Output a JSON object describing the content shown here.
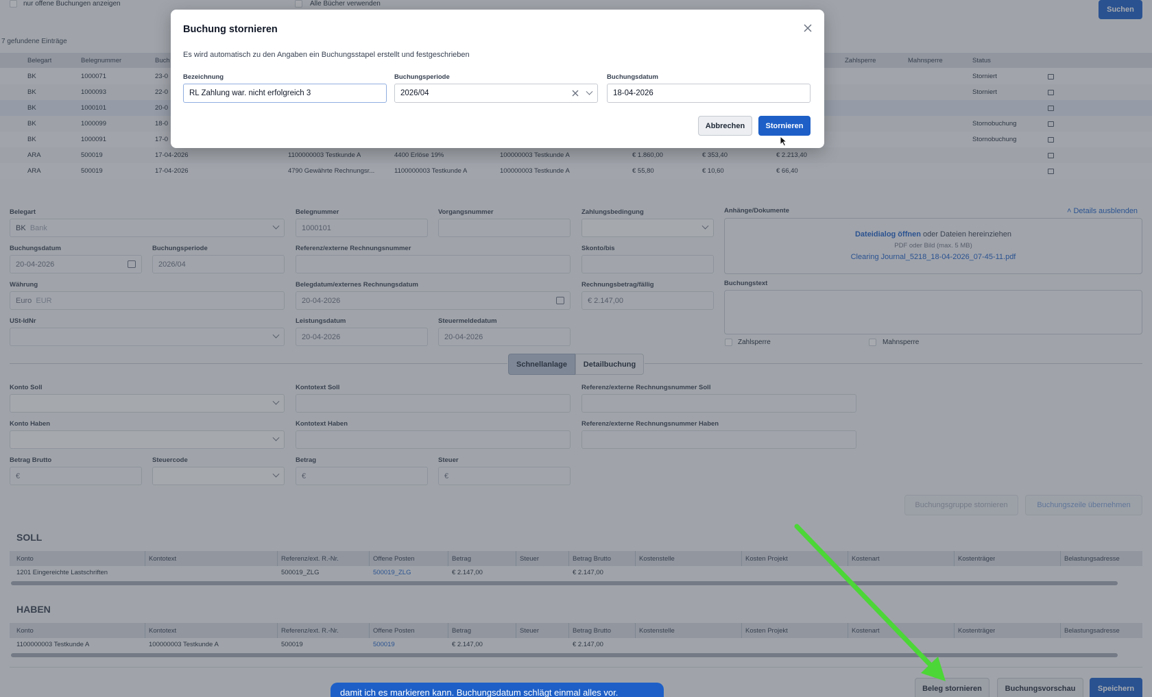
{
  "top_filters": {
    "open_only": "nur offene Buchungen anzeigen",
    "all_books": "Alle Bücher verwenden",
    "search": "Suchen"
  },
  "result_count": "7 gefundene Einträge",
  "result_table": {
    "headers": [
      "Belegart",
      "Belegnummer",
      "Buch",
      "Zahlsperre",
      "Mahnsperre",
      "Status"
    ],
    "rows": [
      {
        "art": "BK",
        "nr": "1000071",
        "date": "23-0",
        "c4": "",
        "c5": "",
        "c6": "",
        "net": "",
        "tax": "",
        "gross": "",
        "status": "Storniert"
      },
      {
        "art": "BK",
        "nr": "1000093",
        "date": "22-0",
        "c4": "",
        "c5": "",
        "c6": "",
        "net": "",
        "tax": "",
        "gross": "",
        "status": "Storniert"
      },
      {
        "art": "BK",
        "nr": "1000101",
        "date": "20-0",
        "c4": "",
        "c5": "",
        "c6": "",
        "net": "",
        "tax": "",
        "gross": "",
        "status": ""
      },
      {
        "art": "BK",
        "nr": "1000099",
        "date": "18-0",
        "c4": "",
        "c5": "",
        "c6": "",
        "net": "",
        "tax": "",
        "gross": "",
        "status": "Stornobuchung"
      },
      {
        "art": "BK",
        "nr": "1000091",
        "date": "17-0",
        "c4": "",
        "c5": "",
        "c6": "",
        "net": "",
        "tax": "",
        "gross": "",
        "status": "Stornobuchung"
      },
      {
        "art": "ARA",
        "nr": "500019",
        "date": "17-04-2026",
        "c4": "1100000003 Testkunde A",
        "c5": "4400 Erlöse 19%",
        "c6": "100000003 Testkunde A",
        "net": "€ 1.860,00",
        "tax": "€ 353,40",
        "gross": "€ 2.213,40",
        "status": ""
      },
      {
        "art": "ARA",
        "nr": "500019",
        "date": "17-04-2026",
        "c4": "4790 Gewährte Rechnungsr...",
        "c5": "1100000003 Testkunde A",
        "c6": "100000003 Testkunde A",
        "net": "€ 55,80",
        "tax": "€ 10,60",
        "gross": "€ 66,40",
        "status": ""
      }
    ]
  },
  "form": {
    "belegart_label": "Belegart",
    "belegart_code": "BK",
    "belegart_name": "Bank",
    "belegnummer_label": "Belegnummer",
    "belegnummer": "1000101",
    "vorgang_label": "Vorgangsnummer",
    "zahlungsbed_label": "Zahlungsbedingung",
    "anhaenge_label": "Anhänge/Dokumente",
    "details_toggle": "Details ausblenden",
    "upload_link": "Dateidialog öffnen",
    "upload_rest": " oder Dateien hereinziehen",
    "upload_hint": "PDF oder Bild (max. 5 MB)",
    "attached_file": "Clearing Journal_5218_18-04-2026_07-45-11.pdf",
    "buchungsdatum_label": "Buchungsdatum",
    "buchungsdatum": "20-04-2026",
    "buchungsperiode_label": "Buchungsperiode",
    "buchungsperiode": "2026/04",
    "referenz_label": "Referenz/externe Rechnungsnummer",
    "skonto_label": "Skonto/bis",
    "waehrung_label": "Währung",
    "waehrung_name": "Euro",
    "waehrung_code": "EUR",
    "belegdatum_label": "Belegdatum/externes Rechnungsdatum",
    "belegdatum": "20-04-2026",
    "rechnungsbetrag_label": "Rechnungsbetrag/fällig",
    "rechnungsbetrag": "€ 2.147,00",
    "buchungstext_label": "Buchungstext",
    "ustid_label": "USt-IdNr",
    "leistungsdatum_label": "Leistungsdatum",
    "leistungsdatum": "20-04-2026",
    "steuermelde_label": "Steuermeldedatum",
    "steuermelde": "20-04-2026",
    "zahlsperre": "Zahlsperre",
    "mahnsperre": "Mahnsperre",
    "tab_schnell": "Schnellanlage",
    "tab_detail": "Detailbuchung",
    "konto_soll_label": "Konto Soll",
    "kontotext_soll_label": "Kontotext Soll",
    "ref_soll_label": "Referenz/externe Rechnungsnummer Soll",
    "konto_haben_label": "Konto Haben",
    "kontotext_haben_label": "Kontotext Haben",
    "ref_haben_label": "Referenz/externe Rechnungsnummer Haben",
    "betrag_brutto_label": "Betrag Brutto",
    "steuercode_label": "Steuercode",
    "betrag_label": "Betrag",
    "steuer_label": "Steuer",
    "euro_placeholder": "€",
    "btn_gruppe_storno": "Buchungsgruppe stornieren",
    "btn_zeile_uebernehmen": "Buchungszeile übernehmen"
  },
  "soll": {
    "title": "SOLL",
    "headers": [
      "Konto",
      "Kontotext",
      "Referenz/ext. R.-Nr.",
      "Offene Posten",
      "Betrag",
      "Steuer",
      "Betrag Brutto",
      "Kostenstelle",
      "Kosten Projekt",
      "Kostenart",
      "Kostenträger",
      "Belastungsadresse"
    ],
    "row": {
      "konto": "1201 Eingereichte Lastschriften",
      "kontotext": "",
      "ref": "500019_ZLG",
      "op": "500019_ZLG",
      "betrag": "€ 2.147,00",
      "steuer": "",
      "brutto": "€ 2.147,00"
    }
  },
  "haben": {
    "title": "HABEN",
    "headers": [
      "Konto",
      "Kontotext",
      "Referenz/ext. R.-Nr.",
      "Offene Posten",
      "Betrag",
      "Steuer",
      "Betrag Brutto",
      "Kostenstelle",
      "Kosten Projekt",
      "Kostenart",
      "Kostenträger",
      "Belastungsadresse"
    ],
    "row": {
      "konto": "1100000003 Testkunde A",
      "kontotext": "100000003 Testkunde A",
      "ref": "500019",
      "op": "500019",
      "betrag": "€ 2.147,00",
      "steuer": "",
      "brutto": "€ 2.147,00"
    }
  },
  "footer": {
    "beleg_stornieren": "Beleg stornieren",
    "vorschau": "Buchungsvorschau",
    "speichern": "Speichern",
    "caption": "damit ich es markieren kann. Buchungsdatum schlägt einmal alles vor."
  },
  "modal": {
    "title": "Buchung stornieren",
    "description": "Es wird automatisch zu den Angaben ein Buchungsstapel erstellt und festgeschrieben",
    "bezeichnung_label": "Bezeichnung",
    "bezeichnung": "RL Zahlung war. nicht erfolgreich 3",
    "periode_label": "Buchungsperiode",
    "periode": "2026/04",
    "datum_label": "Buchungsdatum",
    "datum": "18-04-2026",
    "cancel": "Abbrechen",
    "confirm": "Stornieren"
  },
  "colors": {
    "primary": "#1d5fc7",
    "annotation_arrow": "#4cd637",
    "caption_bg": "#1d5fc7"
  }
}
